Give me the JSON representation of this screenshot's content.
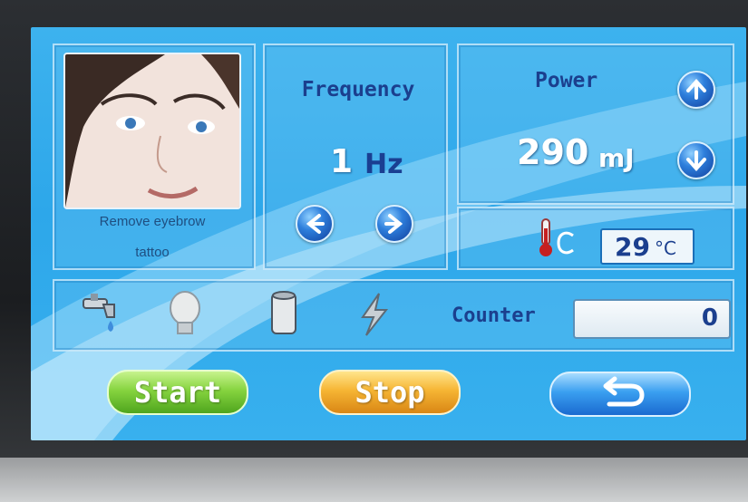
{
  "treatment": {
    "label_line1": "Remove eyebrow",
    "label_line2": "tattoo"
  },
  "frequency": {
    "title": "Frequency",
    "value": "1",
    "unit": "Hz"
  },
  "power": {
    "title": "Power",
    "value": "290",
    "unit": "mJ"
  },
  "temperature": {
    "value": "29",
    "unit": "°C"
  },
  "counter": {
    "label": "Counter",
    "value": "0"
  },
  "buttons": {
    "start": "Start",
    "stop": "Stop"
  },
  "colors": {
    "screen": "#2da7ea",
    "start": "#7fd13b",
    "stop": "#f0a322",
    "back": "#2f9be9"
  },
  "icons": [
    "faucet-icon",
    "lightbulb-icon",
    "cylinder-icon",
    "lightning-icon",
    "thermometer-icon",
    "back-arrow-icon"
  ]
}
